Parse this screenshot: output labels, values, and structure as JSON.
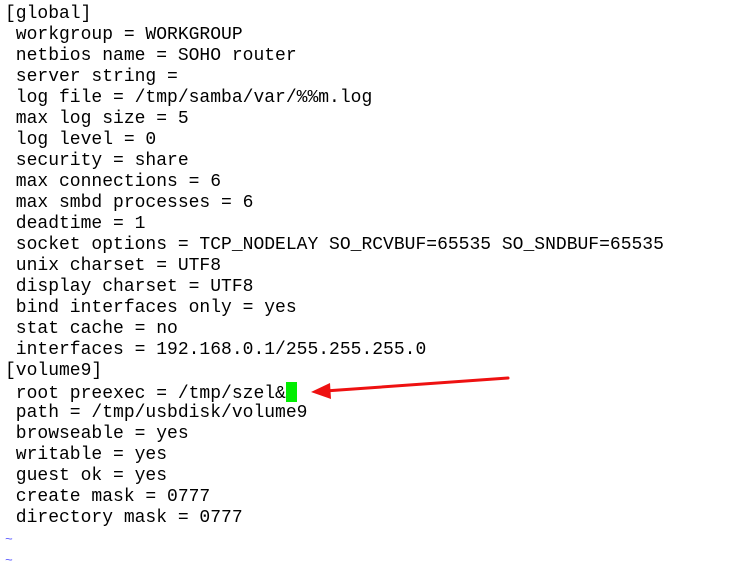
{
  "editor": {
    "lines": [
      "[global]",
      " workgroup = WORKGROUP",
      " netbios name = SOHO router",
      " server string =",
      " log file = /tmp/samba/var/%%m.log",
      " max log size = 5",
      " log level = 0",
      " security = share",
      " max connections = 6",
      " max smbd processes = 6",
      " deadtime = 1",
      " socket options = TCP_NODELAY SO_RCVBUF=65535 SO_SNDBUF=65535",
      " unix charset = UTF8",
      " display charset = UTF8",
      " bind interfaces only = yes",
      " stat cache = no",
      " interfaces = 192.168.0.1/255.255.255.0",
      "[volume9]",
      " root preexec = /tmp/szel&",
      " path = /tmp/usbdisk/volume9",
      " browseable = yes",
      " writable = yes",
      " guest ok = yes",
      " create mask = 0777",
      " directory mask = 0777"
    ],
    "empty_line_marker": "~",
    "empty_line_count": 2,
    "cursor_line_index": 18,
    "cursor_color": "#00ee00",
    "tilde_color": "#5a5aff"
  },
  "annotation": {
    "type": "arrow",
    "color": "#ee1111",
    "points_to": "cursor"
  }
}
